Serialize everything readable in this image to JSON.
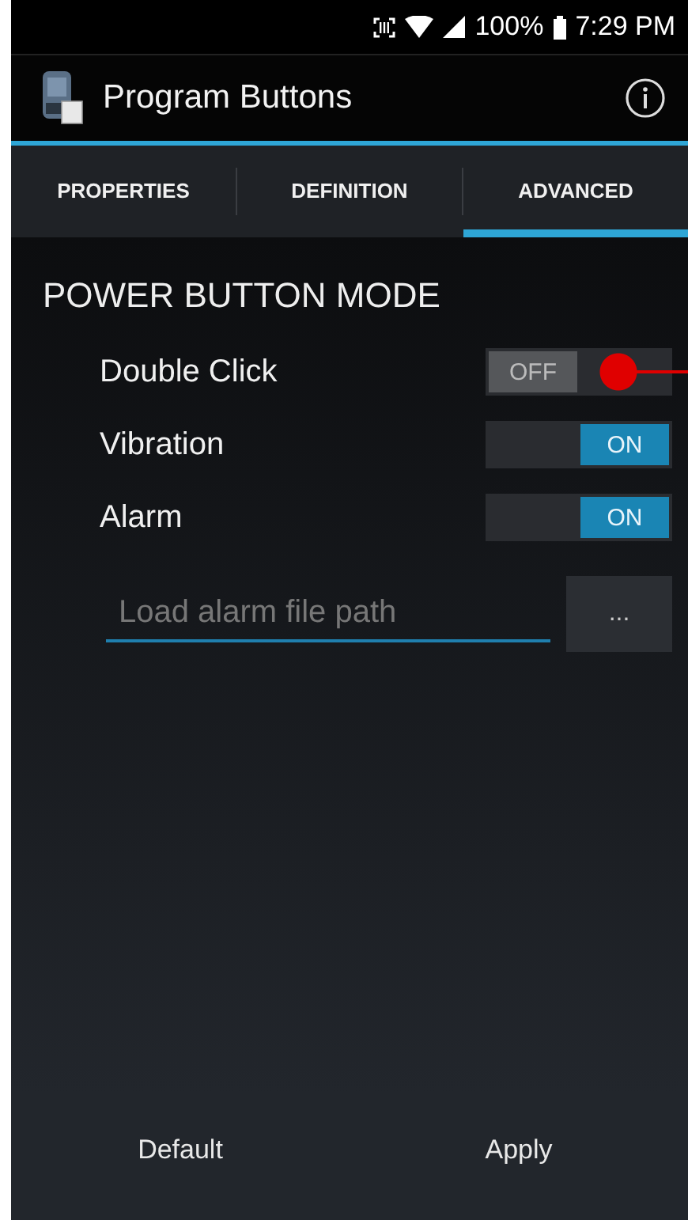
{
  "status_bar": {
    "battery": "100%",
    "time": "7:29 PM"
  },
  "app_bar": {
    "title": "Program Buttons"
  },
  "tabs": [
    {
      "label": "PROPERTIES",
      "selected": false
    },
    {
      "label": "DEFINITION",
      "selected": false
    },
    {
      "label": "ADVANCED",
      "selected": true
    }
  ],
  "section": {
    "title": "POWER BUTTON MODE"
  },
  "settings": [
    {
      "label": "Double Click",
      "on": false,
      "state_label": "OFF",
      "annotated": true
    },
    {
      "label": "Vibration",
      "on": true,
      "state_label": "ON",
      "annotated": false
    },
    {
      "label": "Alarm",
      "on": true,
      "state_label": "ON",
      "annotated": false
    }
  ],
  "file_path": {
    "placeholder": "Load alarm file path",
    "browse": "..."
  },
  "buttons": [
    "Default",
    "Apply"
  ]
}
